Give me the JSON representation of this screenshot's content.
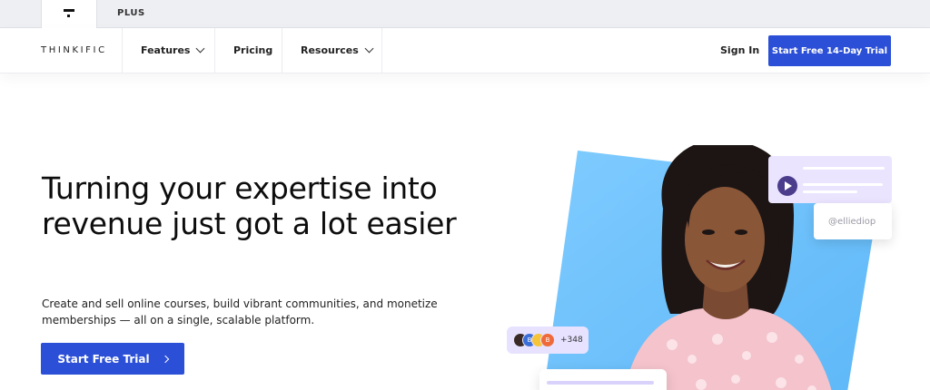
{
  "topbar": {
    "plus_label": "PLUS"
  },
  "nav": {
    "brand": "THINKIFIC",
    "items": [
      {
        "label": "Features",
        "has_dropdown": true
      },
      {
        "label": "Pricing",
        "has_dropdown": false
      },
      {
        "label": "Resources",
        "has_dropdown": true
      }
    ],
    "sign_in": "Sign In",
    "cta": "Start Free 14-Day Trial"
  },
  "hero": {
    "title": "Turning your expertise into revenue just got a lot easier",
    "subtitle": "Create and sell online courses, build vibrant communities, and monetize memberships — all on a single, scalable platform.",
    "cta": "Start Free Trial"
  },
  "visual": {
    "handle": "@elliediop",
    "member_count": "+348",
    "avatar_letters": [
      "",
      "B",
      "",
      "B"
    ]
  },
  "colors": {
    "accent": "#2b4fd6",
    "panel_blue": "#6fc4fb",
    "card_lilac": "#eae4ff"
  }
}
